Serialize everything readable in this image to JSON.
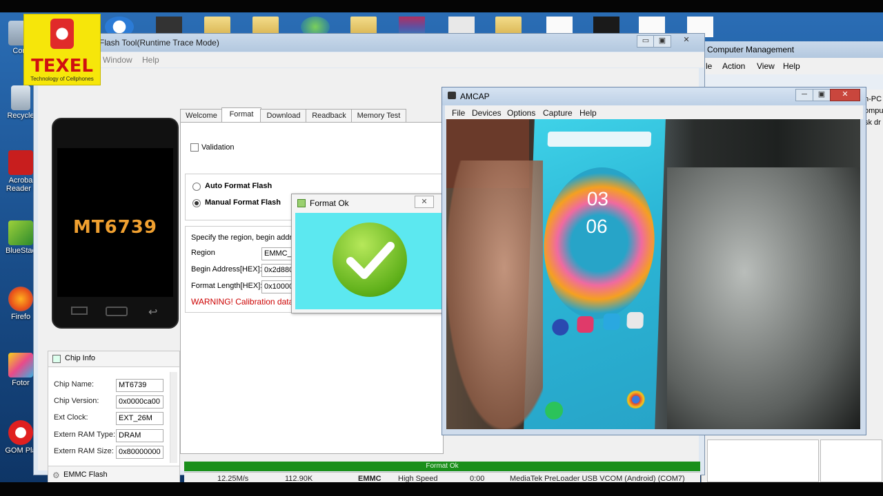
{
  "desktop": {
    "icons": [
      {
        "label": "Com",
        "name": "computer"
      },
      {
        "label": "Recycle",
        "name": "recycle-bin"
      },
      {
        "label": "Acroba\nReader I",
        "name": "acrobat-reader"
      },
      {
        "label": "BlueStac",
        "name": "bluestacks"
      },
      {
        "label": "Firefo",
        "name": "firefox"
      },
      {
        "label": "Fotor",
        "name": "fotor"
      },
      {
        "label": "GOM Pla",
        "name": "gom-player"
      }
    ]
  },
  "logo": {
    "title": "TEXEL",
    "subtitle": "Technology of Cellphones"
  },
  "flash_tool": {
    "title": "Flash Tool(Runtime Trace Mode)",
    "menu": [
      "Window",
      "Help"
    ],
    "window_buttons": [
      "▭",
      "▣",
      "✕"
    ],
    "phone_chip": "MT6739",
    "tabs": [
      "Welcome",
      "Format",
      "Download",
      "Readback",
      "Memory Test"
    ],
    "active_tab": "Format",
    "validation_label": "Validation",
    "auto_format": "Auto Format Flash",
    "manual_format": "Manual Format Flash",
    "specify_text": "Specify the region, begin addres",
    "region_label": "Region",
    "region_value": "EMMC_U",
    "begin_label": "Begin Address[HEX]:",
    "begin_value": "0x2d880",
    "length_label": "Format Length[HEX]:",
    "length_value": "0x10000",
    "warning": "WARNING! Calibration data",
    "chip_info": {
      "title": "Chip Info",
      "rows": [
        {
          "label": "Chip Name:",
          "value": "MT6739"
        },
        {
          "label": "Chip Version:",
          "value": "0x0000ca00"
        },
        {
          "label": "Ext Clock:",
          "value": "EXT_26M"
        },
        {
          "label": "Extern RAM Type:",
          "value": "DRAM"
        },
        {
          "label": "Extern RAM Size:",
          "value": "0x80000000"
        }
      ],
      "emmc_flash": "EMMC Flash"
    },
    "progress_label": "Format",
    "progress_trail": "Ok",
    "progress_pct": 100,
    "status": {
      "speed": "12.25M/s",
      "size": "112.90K",
      "storage": "EMMC",
      "mode": "High Speed",
      "time": "0:00",
      "port": "MediaTek PreLoader USB VCOM (Android) (COM7)"
    }
  },
  "format_ok_dialog": {
    "title": "Format Ok",
    "close": "✕"
  },
  "computer_management": {
    "title": "Computer Management",
    "menu": [
      "le",
      "Action",
      "View",
      "Help"
    ],
    "side_text": [
      "n-PC",
      "ompu",
      "sk dr"
    ]
  },
  "amcap": {
    "title": "AMCAP",
    "menu": [
      "File",
      "Devices",
      "Options",
      "Capture",
      "Help"
    ],
    "window_buttons": [
      "─",
      "▣",
      "✕"
    ],
    "video_clock": [
      "03",
      "06"
    ]
  },
  "colors": {
    "progress_green": "#1a8f1a",
    "warning_red": "#cc0000",
    "chip_orange": "#f0a030",
    "dialog_cyan": "#5ce8f0",
    "logo_yellow": "#f6e60a",
    "logo_red": "#d01010"
  }
}
